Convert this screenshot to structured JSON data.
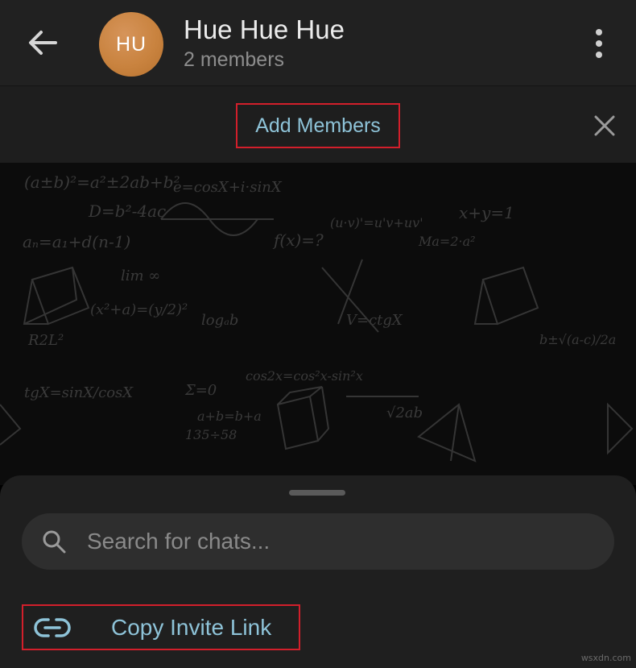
{
  "header": {
    "back_icon": "arrow-left-icon",
    "avatar_initials": "HU",
    "avatar_color": "#c9833f",
    "title": "Hue Hue Hue",
    "subtitle": "2 members",
    "more_icon": "more-vertical-icon"
  },
  "add_bar": {
    "add_members_label": "Add Members",
    "close_icon": "close-icon",
    "accent_color": "#8ec3d8",
    "highlight_color": "#d21f2b"
  },
  "chat_background": {
    "doodles": [
      "(a±b)²=a²±2ab+b²",
      "e=cosX+i·sinX",
      "D=b²-4ac",
      "aₙ=a₁+d(n-1)",
      "f(x)=?",
      "lim ∞",
      "logₐb",
      "x+y=1",
      "Σ=0",
      "tgX=sinX/cosX",
      "(x²+a)=(y/2)²",
      "R2L²",
      "cos2x=cos²x-sin²x",
      "√2ab",
      "135÷58",
      "a+b=b+a",
      "b±√(a-c)/2a",
      "Ma=2·a²",
      "(u·v)'=u'v+uv'",
      "V=ctgX"
    ]
  },
  "sheet": {
    "search_icon": "search-icon",
    "search_placeholder": "Search for chats...",
    "link_icon": "link-icon",
    "copy_invite_label": "Copy Invite Link"
  },
  "watermark": "wsxdn.com"
}
